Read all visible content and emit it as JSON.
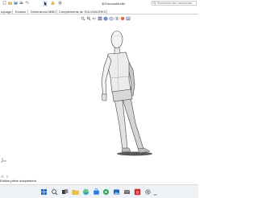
{
  "window": {
    "title": "3DHumanModel",
    "search_placeholder": "Rechercher des commandes"
  },
  "tabs": [
    {
      "label": "uquage"
    },
    {
      "label": "Evaluer"
    },
    {
      "label": "Dimensions MBD"
    },
    {
      "label": "Compléments de SOLIDWORKS"
    }
  ],
  "status": {
    "text": "Edition pièce uniquement"
  },
  "icons": {
    "quick_access": [
      "new-doc-icon",
      "open-icon",
      "save-icon",
      "print-icon",
      "undo-icon",
      "select-pointer-icon",
      "rebuild-icon",
      "options-icon"
    ],
    "view_toolbar": [
      "zoom-fit-icon",
      "zoom-area-icon",
      "previous-view-icon",
      "section-view-icon",
      "view-orientation-icon",
      "display-style-icon",
      "hide-show-icon",
      "appearance-icon",
      "scene-icon"
    ],
    "taskbar": [
      "windows-start-icon",
      "taskbar-search-icon",
      "task-view-icon",
      "file-explorer-icon",
      "edge-browser-icon",
      "store-icon",
      "teams-icon",
      "photos-icon",
      "solidworks-icon",
      "settings-icon"
    ]
  },
  "colors": {
    "accent_blue": "#2b5fb4",
    "solidworks_red": "#d7262e",
    "taskbar_bg": "#eef1f6"
  }
}
